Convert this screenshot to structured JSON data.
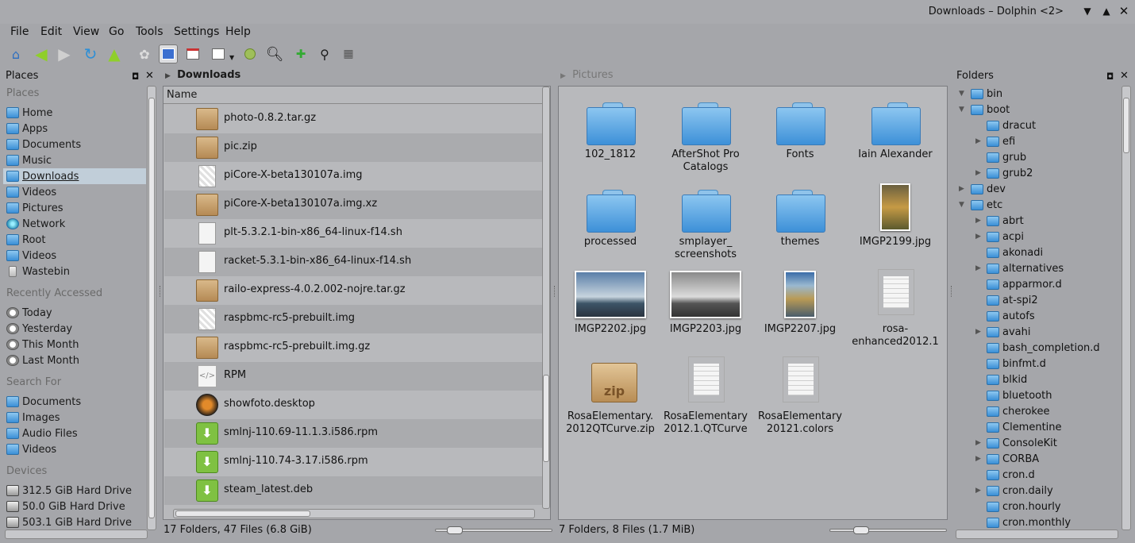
{
  "window": {
    "title": "Downloads – Dolphin <2>"
  },
  "menu": [
    "File",
    "Edit",
    "View",
    "Go",
    "Tools",
    "Settings",
    "Help"
  ],
  "places": {
    "title": "Places",
    "section_places": "Places",
    "items": [
      "Home",
      "Apps",
      "Documents",
      "Music",
      "Downloads",
      "Videos",
      "Pictures",
      "Network",
      "Root",
      "Videos",
      "Wastebin"
    ],
    "section_recent": "Recently Accessed",
    "recent": [
      "Today",
      "Yesterday",
      "This Month",
      "Last Month"
    ],
    "section_search": "Search For",
    "search": [
      "Documents",
      "Images",
      "Audio Files",
      "Videos"
    ],
    "section_devices": "Devices",
    "devices": [
      "312.5 GiB Hard Drive",
      "50.0 GiB Hard Drive",
      "503.1 GiB Hard Drive"
    ]
  },
  "left_view": {
    "breadcrumb": "Downloads",
    "column_name": "Name",
    "files": [
      "photo-0.8.2.tar.gz",
      "pic.zip",
      "piCore-X-beta130107a.img",
      "piCore-X-beta130107a.img.xz",
      "plt-5.3.2.1-bin-x86_64-linux-f14.sh",
      "racket-5.3.1-bin-x86_64-linux-f14.sh",
      "railo-express-4.0.2.002-nojre.tar.gz",
      "raspbmc-rc5-prebuilt.img",
      "raspbmc-rc5-prebuilt.img.gz",
      "RPM",
      "showfoto.desktop",
      "smlnj-110.69-11.1.3.i586.rpm",
      "smlnj-110.74-3.17.i586.rpm",
      "steam_latest.deb"
    ],
    "status": "17 Folders, 47 Files (6.8 GiB)"
  },
  "right_view": {
    "breadcrumb": "Pictures",
    "items": [
      [
        "102_1812",
        ""
      ],
      [
        "AfterShot Pro",
        "Catalogs"
      ],
      [
        "Fonts",
        ""
      ],
      [
        "Iain Alexander",
        ""
      ],
      [
        "processed",
        ""
      ],
      [
        "smplayer_",
        "screenshots"
      ],
      [
        "themes",
        ""
      ],
      [
        "IMGP2199.jpg",
        ""
      ],
      [
        "IMGP2202.jpg",
        ""
      ],
      [
        "IMGP2203.jpg",
        ""
      ],
      [
        "IMGP2207.jpg",
        ""
      ],
      [
        "rosa-",
        "enhanced2012.1"
      ],
      [
        "RosaElementary.",
        "2012QTCurve.zip"
      ],
      [
        "RosaElementary",
        "2012.1.QTCurve"
      ],
      [
        "RosaElementary",
        "20121.colors"
      ]
    ],
    "status": "7 Folders, 8 Files (1.7 MiB)"
  },
  "folders": {
    "title": "Folders",
    "items": [
      "bin",
      "boot",
      "dracut",
      "efi",
      "grub",
      "grub2",
      "dev",
      "etc",
      "abrt",
      "acpi",
      "akonadi",
      "alternatives",
      "apparmor.d",
      "at-spi2",
      "autofs",
      "avahi",
      "bash_completion.d",
      "binfmt.d",
      "blkid",
      "bluetooth",
      "cherokee",
      "Clementine",
      "ConsoleKit",
      "CORBA",
      "cron.d",
      "cron.daily",
      "cron.hourly",
      "cron.monthly"
    ]
  },
  "zip_label": "zip"
}
